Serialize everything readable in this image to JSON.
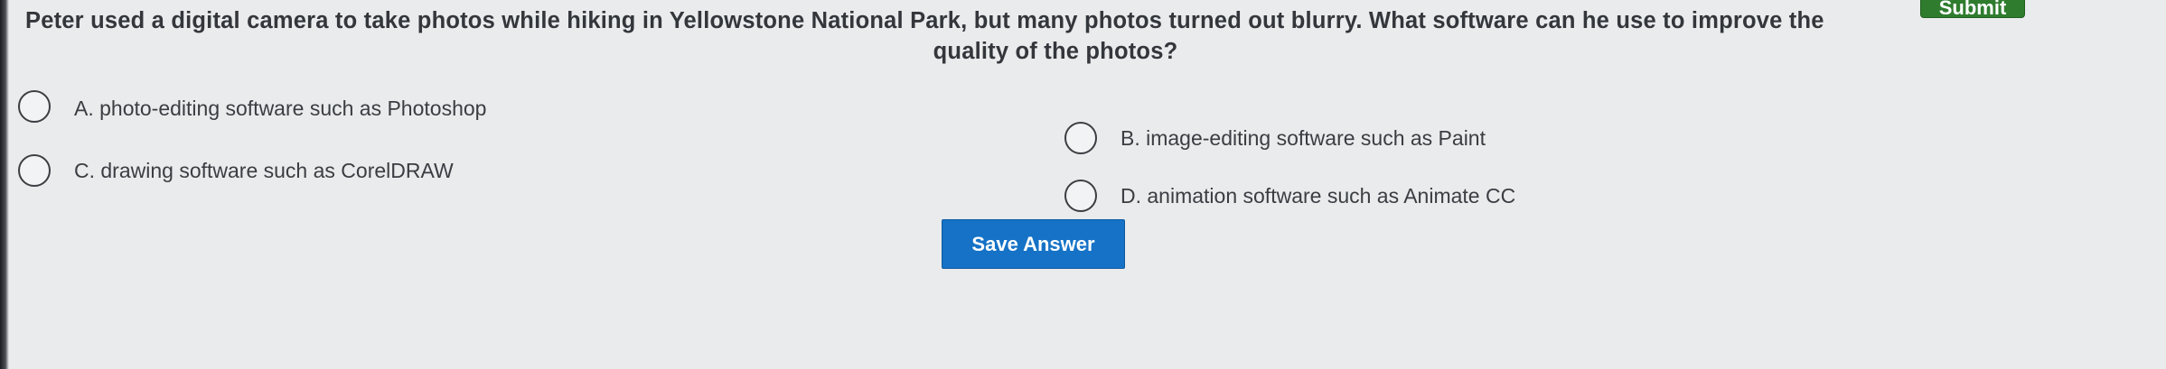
{
  "header": {
    "submit_label": "Submit"
  },
  "question": {
    "line1": "Peter used a digital camera to take photos while hiking in Yellowstone National Park, but many photos turned out blurry. What software can he use to improve the",
    "line2": "quality of the photos?"
  },
  "options": [
    {
      "label": "A. photo-editing software such as Photoshop",
      "selected": false
    },
    {
      "label": "B. image-editing software such as Paint",
      "selected": false
    },
    {
      "label": "C. drawing software such as CorelDRAW",
      "selected": false
    },
    {
      "label": "D. animation software such as Animate CC",
      "selected": false
    }
  ],
  "actions": {
    "save_label": "Save Answer"
  },
  "colors": {
    "save_button": "#1572c6",
    "submit_button": "#2f7c2f",
    "background": "#e9ebec"
  }
}
